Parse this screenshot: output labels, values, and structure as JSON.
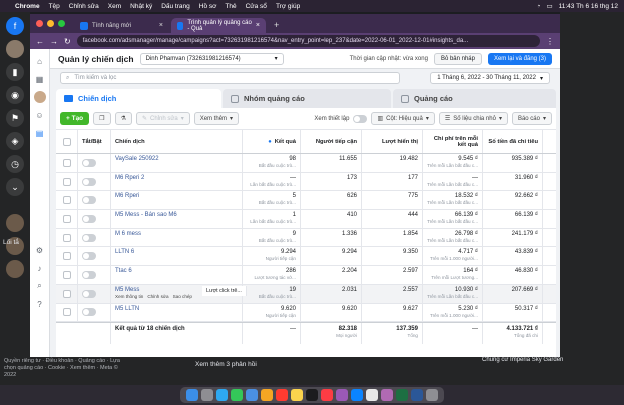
{
  "menubar": {
    "apple": "",
    "app": "Chrome",
    "items": [
      "Tệp",
      "Chỉnh sửa",
      "Xem",
      "Nhật ký",
      "Dấu trang",
      "Hồ sơ",
      "Thẻ",
      "Cửa sổ",
      "Trợ giúp"
    ],
    "clock": "11:43 Th 6 16 thg 12"
  },
  "browser": {
    "tabs": [
      {
        "title": "Tính năng mới"
      },
      {
        "title": "Trình quản lý quảng cáo - Quả"
      }
    ],
    "url": "facebook.com/adsmanager/manage/campaigns?act=732631981216574&nav_entry_point=lep_237&date=2022-06-01_2022-12-01#insights_da..."
  },
  "header": {
    "title": "Quản lý chiến dịch",
    "account": "Dinh Phamvan (732631981216574)",
    "update": "Thời gian cập nhật: vừa xong",
    "draft_btn": "Bỏ bản nháp",
    "review_btn": "Xem lại và đăng (3)"
  },
  "search": {
    "placeholder": "Tìm kiếm và lọc",
    "daterange": "1 Tháng 6, 2022 - 30 Tháng 11, 2022"
  },
  "tabs": [
    "Chiến dịch",
    "Nhóm quảng cáo",
    "Quảng cáo"
  ],
  "toolbar": {
    "create": "+ Tạo",
    "edit": "Chỉnh sửa",
    "more": "Xem thêm",
    "view_setup": "Xem thiết lập",
    "columns": "Cột: Hiệu quả",
    "breakdown": "Số liệu chia nhỏ",
    "reports": "Báo cáo"
  },
  "table": {
    "headers": {
      "toggle": "Tắt/Bật",
      "name": "Chiến dịch",
      "results": "Kết quả",
      "reach": "Người tiếp cận",
      "impressions": "Lượt hiển thị",
      "cost": "Chi phí trên mỗi kết quả",
      "spent": "Số tiền đã chi tiêu"
    },
    "rows": [
      {
        "name": "VaySale 250922",
        "results": "98",
        "results_sub": "Bắt đầu cuộc trò...",
        "reach": "11.655",
        "impressions": "19.482",
        "cost": "9.545 ₫",
        "cost_sub": "Trên mỗi Lần bắt đầu c...",
        "spent": "935.389 ₫"
      },
      {
        "name": "M6 Rperi 2",
        "results": "—",
        "results_sub": "Lần bắt đầu cuộc trò...",
        "reach": "173",
        "impressions": "177",
        "cost": "—",
        "cost_sub": "Trên mỗi Lần bắt đầu c...",
        "spent": "31.960 ₫"
      },
      {
        "name": "M6 Rperi",
        "results": "5",
        "results_sub": "Bắt đầu cuộc trò...",
        "reach": "626",
        "impressions": "775",
        "cost": "18.532 ₫",
        "cost_sub": "Trên mỗi Lần bắt đầu c...",
        "spent": "92.662 ₫"
      },
      {
        "name": "M5 Mess - Bán sao M6",
        "results": "1",
        "results_sub": "Lần bắt đầu cuộc trò...",
        "reach": "410",
        "impressions": "444",
        "cost": "66.139 ₫",
        "cost_sub": "Trên mỗi Lần bắt đầu c...",
        "spent": "66.139 ₫"
      },
      {
        "name": "M 6 mess",
        "results": "9",
        "results_sub": "Bắt đầu cuộc trò...",
        "reach": "1.336",
        "impressions": "1.854",
        "cost": "26.798 ₫",
        "cost_sub": "Trên mỗi Lần bắt đầu c...",
        "spent": "241.179 ₫"
      },
      {
        "name": "LLTN 6",
        "results": "9.294",
        "results_sub": "Người tiếp cận",
        "reach": "9.294",
        "impressions": "9.350",
        "cost": "4.717 ₫",
        "cost_sub": "Trên mỗi 1.000 người...",
        "spent": "43.839 ₫"
      },
      {
        "name": "Ttac 6",
        "results": "286",
        "results_sub": "Lượt tương tác vớ...",
        "reach": "2.204",
        "impressions": "2.597",
        "cost": "164 ₫",
        "cost_sub": "Trên mỗi Lượt tương...",
        "spent": "46.830 ₫"
      },
      {
        "name": "M5 Mess",
        "results": "19",
        "results_sub": "Bắt đầu cuộc trò...",
        "reach": "2.031",
        "impressions": "2.557",
        "cost": "10.930 ₫",
        "cost_sub": "Trên mỗi Lần bắt đầu c...",
        "spent": "207.669 ₫",
        "actions": [
          "Xem thông tin",
          "Chỉnh sửa",
          "Sao chép"
        ],
        "tooltip": "Lượt click trê..."
      },
      {
        "name": "M5 LLTN",
        "results": "9.620",
        "results_sub": "Người tiếp cận",
        "reach": "9.620",
        "impressions": "9.627",
        "cost": "5.230 ₫",
        "cost_sub": "Trên mỗi 1.000 người...",
        "spent": "50.317 ₫"
      }
    ],
    "total": {
      "label": "Kết quả từ 18 chiến dịch",
      "results": "—",
      "reach": "82.318",
      "reach_sub": "Mọi người",
      "impressions": "137.359",
      "imp_sub": "Tổng",
      "cost": "—",
      "spent": "4.133.721 ₫",
      "spent_sub": "Tổng đã chi"
    }
  },
  "desktop": {
    "left_label": "Lối tắ",
    "bottom_left": "Quyền riêng tư · Điều khoản · Quảng cáo · Lựa chọn quảng cáo · Cookie · Xem thêm · Meta © 2022",
    "reply": "Xem thêm 3 phản hồi",
    "notif": "Chung cư Imperia Sky Garden"
  }
}
